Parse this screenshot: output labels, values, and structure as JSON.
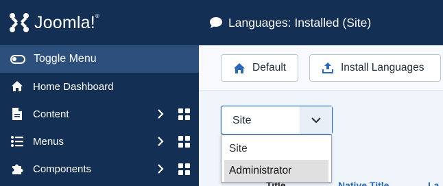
{
  "brand": {
    "name": "Joomla!",
    "reg": "®"
  },
  "sidebar": {
    "toggle_label": "Toggle Menu",
    "items": [
      {
        "label": "Home Dashboard",
        "icon": "home-icon",
        "has_submenu": false
      },
      {
        "label": "Content",
        "icon": "file-icon",
        "has_submenu": true
      },
      {
        "label": "Menus",
        "icon": "list-icon",
        "has_submenu": true
      },
      {
        "label": "Components",
        "icon": "puzzle-icon",
        "has_submenu": true
      }
    ]
  },
  "header": {
    "title": "Languages: Installed (Site)",
    "icon": "comment-icon"
  },
  "toolbar": {
    "default_label": "Default",
    "install_label": "Install Languages"
  },
  "filter": {
    "selected": "Site",
    "options": [
      "Site",
      "Administrator"
    ],
    "highlighted": "Administrator"
  },
  "table": {
    "col_title": "Title",
    "col_native": "Native Title",
    "col_lang": "La"
  },
  "colors": {
    "sidebar_bg": "#132f53",
    "active_bg": "#2c4f7c",
    "accent": "#2a69b8"
  }
}
